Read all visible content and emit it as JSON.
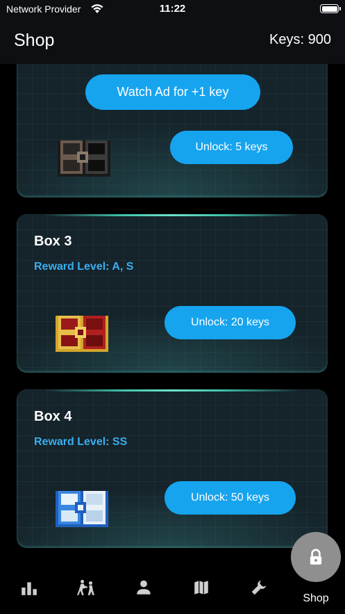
{
  "status_bar": {
    "carrier": "Network Provider",
    "time": "11:22"
  },
  "header": {
    "title": "Shop",
    "keys": "Keys: 900"
  },
  "watch_ad_label": "Watch Ad for +1 key",
  "boxes": [
    {
      "title": "",
      "reward": "",
      "unlock_label": "Unlock: 5 keys",
      "chest": "dark-chest-icon"
    },
    {
      "title": "Box 3",
      "reward": "Reward Level: A, S",
      "unlock_label": "Unlock: 20 keys",
      "chest": "red-chest-icon"
    },
    {
      "title": "Box 4",
      "reward": "Reward Level: SS",
      "unlock_label": "Unlock: 50 keys",
      "chest": "blue-chest-icon"
    }
  ],
  "tabs": [
    {
      "icon": "bar-chart-icon"
    },
    {
      "icon": "fight-icon"
    },
    {
      "icon": "person-icon"
    },
    {
      "icon": "map-icon"
    },
    {
      "icon": "wrench-icon"
    },
    {
      "icon": "lock-icon",
      "label": "Shop",
      "active": true
    }
  ],
  "colors": {
    "accent": "#16a4ef",
    "reward_text": "#3aaef0",
    "card_bg": "#15232a",
    "glow": "#3fc2aa",
    "active_tab_bg": "#8f8f8f"
  }
}
